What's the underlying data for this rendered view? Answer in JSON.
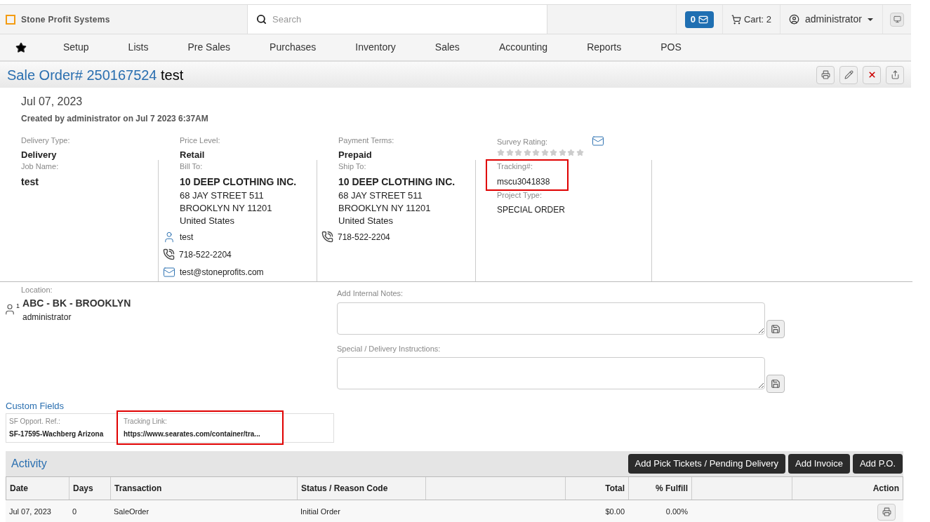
{
  "header": {
    "brand": "Stone Profit Systems",
    "search": {
      "placeholder": "Search"
    },
    "messages": "0",
    "cart": "Cart: 2",
    "user": "administrator"
  },
  "nav": {
    "items": [
      "Setup",
      "Lists",
      "Pre Sales",
      "Purchases",
      "Inventory",
      "Sales",
      "Accounting",
      "Reports",
      "POS"
    ]
  },
  "title": {
    "number": "Sale Order# 250167524",
    "name": "test"
  },
  "order": {
    "date": "Jul 07, 2023",
    "created": "Created by administrator on Jul 7 2023 6:37AM",
    "fields": [
      {
        "label": "Delivery Type:",
        "value": "Delivery"
      },
      {
        "label": "Price Level:",
        "value": "Retail"
      },
      {
        "label": "Payment Terms:",
        "value": "Prepaid"
      }
    ],
    "survey": {
      "label": "Survey Rating:",
      "stars": 0
    },
    "job": {
      "label": "Job Name:",
      "value": "test"
    },
    "bill_to": {
      "label": "Bill To:",
      "company": "10 DEEP CLOTHING INC.",
      "lines": [
        "68 JAY STREET 511",
        "BROOKLYN NY 11201",
        "United States"
      ],
      "contact": "test",
      "phone": "718-522-2204",
      "email": "test@stoneprofits.com"
    },
    "ship_to": {
      "label": "Ship To:",
      "company": "10 DEEP CLOTHING INC.",
      "lines": [
        "68 JAY STREET 511",
        "BROOKLYN NY 11201",
        "United States"
      ],
      "phone": "718-522-2204"
    },
    "tracking": {
      "label": "Tracking#:",
      "value": "mscu3041838",
      "highlighted": true
    },
    "project": {
      "label": "Project Type:",
      "value": "SPECIAL ORDER"
    },
    "location": {
      "label": "Location:",
      "value": "ABC - BK - BROOKLYN",
      "user": "administrator",
      "badge": "1"
    },
    "notes": [
      {
        "label": "Add Internal Notes:"
      },
      {
        "label": "Special / Delivery Instructions:"
      }
    ]
  },
  "custom_fields": {
    "title": "Custom Fields",
    "items": [
      {
        "label": "SF Opport. Ref.:",
        "value": "SF-17595-Wachberg Arizona",
        "highlighted": false
      },
      {
        "label": "Tracking Link:",
        "value": "https://www.searates.com/container/tra...",
        "highlighted": true
      }
    ]
  },
  "activity": {
    "title": "Activity",
    "buttons": [
      "Add Pick Tickets / Pending Delivery",
      "Add Invoice",
      "Add P.O."
    ],
    "columns": [
      {
        "kind": "text",
        "label": "Date"
      },
      {
        "kind": "text",
        "label": "Days"
      },
      {
        "kind": "text",
        "label": "Transaction"
      },
      {
        "kind": "text",
        "label": "Status / Reason Code"
      },
      {
        "kind": "blank"
      },
      {
        "kind": "number",
        "label": "Total"
      },
      {
        "kind": "number",
        "label": "% Fulfill"
      },
      {
        "kind": "blank"
      },
      {
        "kind": "action",
        "label": "Action"
      }
    ],
    "rows": [
      {
        "cells": [
          "Jul 07, 2023",
          "0",
          "SaleOrder",
          "Initial Order",
          "",
          "$0.00",
          "0.00%",
          "",
          ""
        ]
      }
    ]
  }
}
